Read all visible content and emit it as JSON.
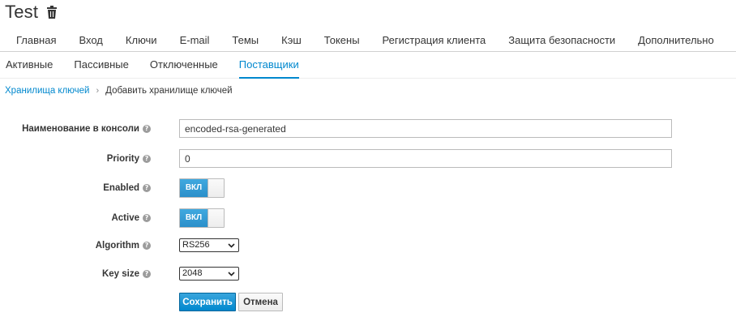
{
  "header": {
    "title": "Test",
    "delete_icon": "trash-icon"
  },
  "main_tabs": [
    {
      "label": "Главная"
    },
    {
      "label": "Вход"
    },
    {
      "label": "Ключи"
    },
    {
      "label": "E-mail"
    },
    {
      "label": "Темы"
    },
    {
      "label": "Кэш"
    },
    {
      "label": "Токены"
    },
    {
      "label": "Регистрация клиента"
    },
    {
      "label": "Защита безопасности"
    },
    {
      "label": "Дополнительно"
    }
  ],
  "sub_tabs": [
    {
      "label": "Активные",
      "active": false
    },
    {
      "label": "Пассивные",
      "active": false
    },
    {
      "label": "Отключенные",
      "active": false
    },
    {
      "label": "Поставщики",
      "active": true
    }
  ],
  "breadcrumb": {
    "parent": "Хранилища ключей",
    "separator": "›",
    "current": "Добавить хранилище ключей"
  },
  "form": {
    "console_name": {
      "label": "Наименование в консоли",
      "value": "encoded-rsa-generated"
    },
    "priority": {
      "label": "Priority",
      "value": "0"
    },
    "enabled": {
      "label": "Enabled",
      "state": "ВКЛ"
    },
    "active": {
      "label": "Active",
      "state": "ВКЛ"
    },
    "algorithm": {
      "label": "Algorithm",
      "selected": "RS256"
    },
    "key_size": {
      "label": "Key size",
      "selected": "2048"
    },
    "help_glyph": "?"
  },
  "actions": {
    "save_label": "Сохранить",
    "cancel_label": "Отмена"
  },
  "colors": {
    "accent": "#0088ce",
    "switch_on": "#39a5dc"
  }
}
